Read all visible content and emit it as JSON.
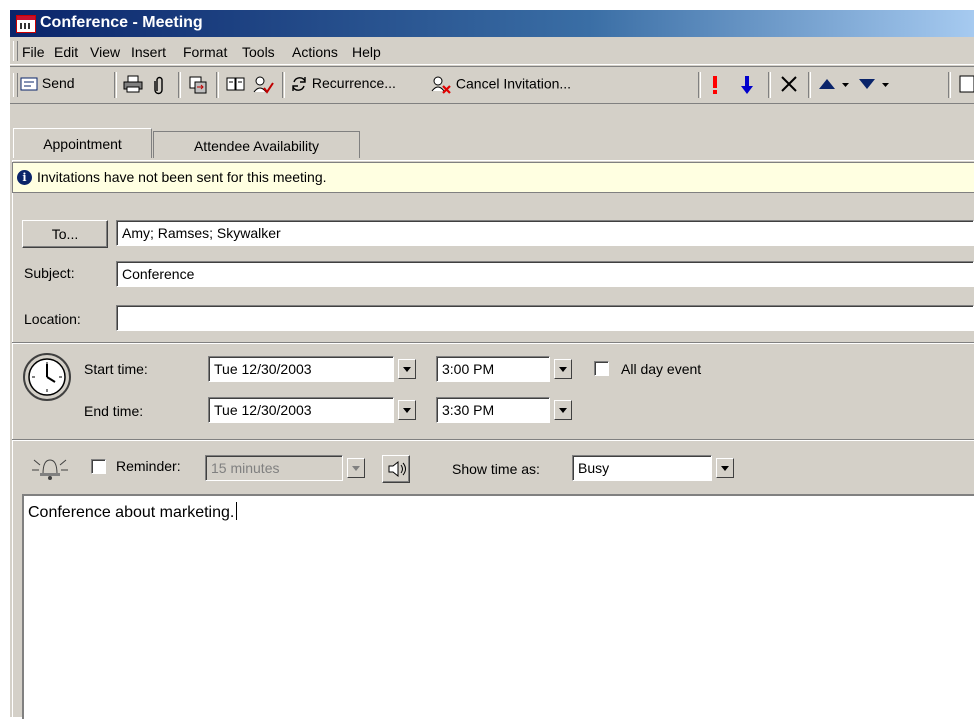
{
  "window": {
    "title": "Conference - Meeting"
  },
  "menu": [
    "File",
    "Edit",
    "View",
    "Insert",
    "Format",
    "Tools",
    "Actions",
    "Help"
  ],
  "toolbar": {
    "send": "Send",
    "recurrence": "Recurrence...",
    "cancel_invitation": "Cancel Invitation..."
  },
  "tabs": [
    "Appointment",
    "Attendee Availability"
  ],
  "info": "Invitations have not been sent for this meeting.",
  "form": {
    "to_button": "To...",
    "to_value": "Amy; Ramses; Skywalker",
    "subject_label": "Subject:",
    "subject_value": "Conference",
    "location_label": "Location:",
    "location_value": "",
    "start_label": "Start time:",
    "start_date": "Tue 12/30/2003",
    "start_time": "3:00 PM",
    "all_day_label": "All day event",
    "end_label": "End time:",
    "end_date": "Tue 12/30/2003",
    "end_time": "3:30 PM",
    "reminder_label": "Reminder:",
    "reminder_value": "15 minutes",
    "show_time_label": "Show time as:",
    "show_time_value": "Busy"
  },
  "body_text": "Conference about marketing.",
  "icons": [
    "calendar-icon",
    "send-icon",
    "print-icon",
    "attach-icon",
    "forward-icon",
    "address-book-icon",
    "check-names-icon",
    "recurrence-icon",
    "cancel-invitation-icon",
    "importance-high-icon",
    "importance-low-icon",
    "delete-icon",
    "previous-item-icon",
    "next-item-icon",
    "clock-icon",
    "bell-icon",
    "sound-icon",
    "info-icon"
  ],
  "colors": {
    "titlebar": "#0a246a",
    "infobar": "#ffffe1",
    "importance_high": "#ff0000",
    "importance_low": "#0000cc"
  }
}
